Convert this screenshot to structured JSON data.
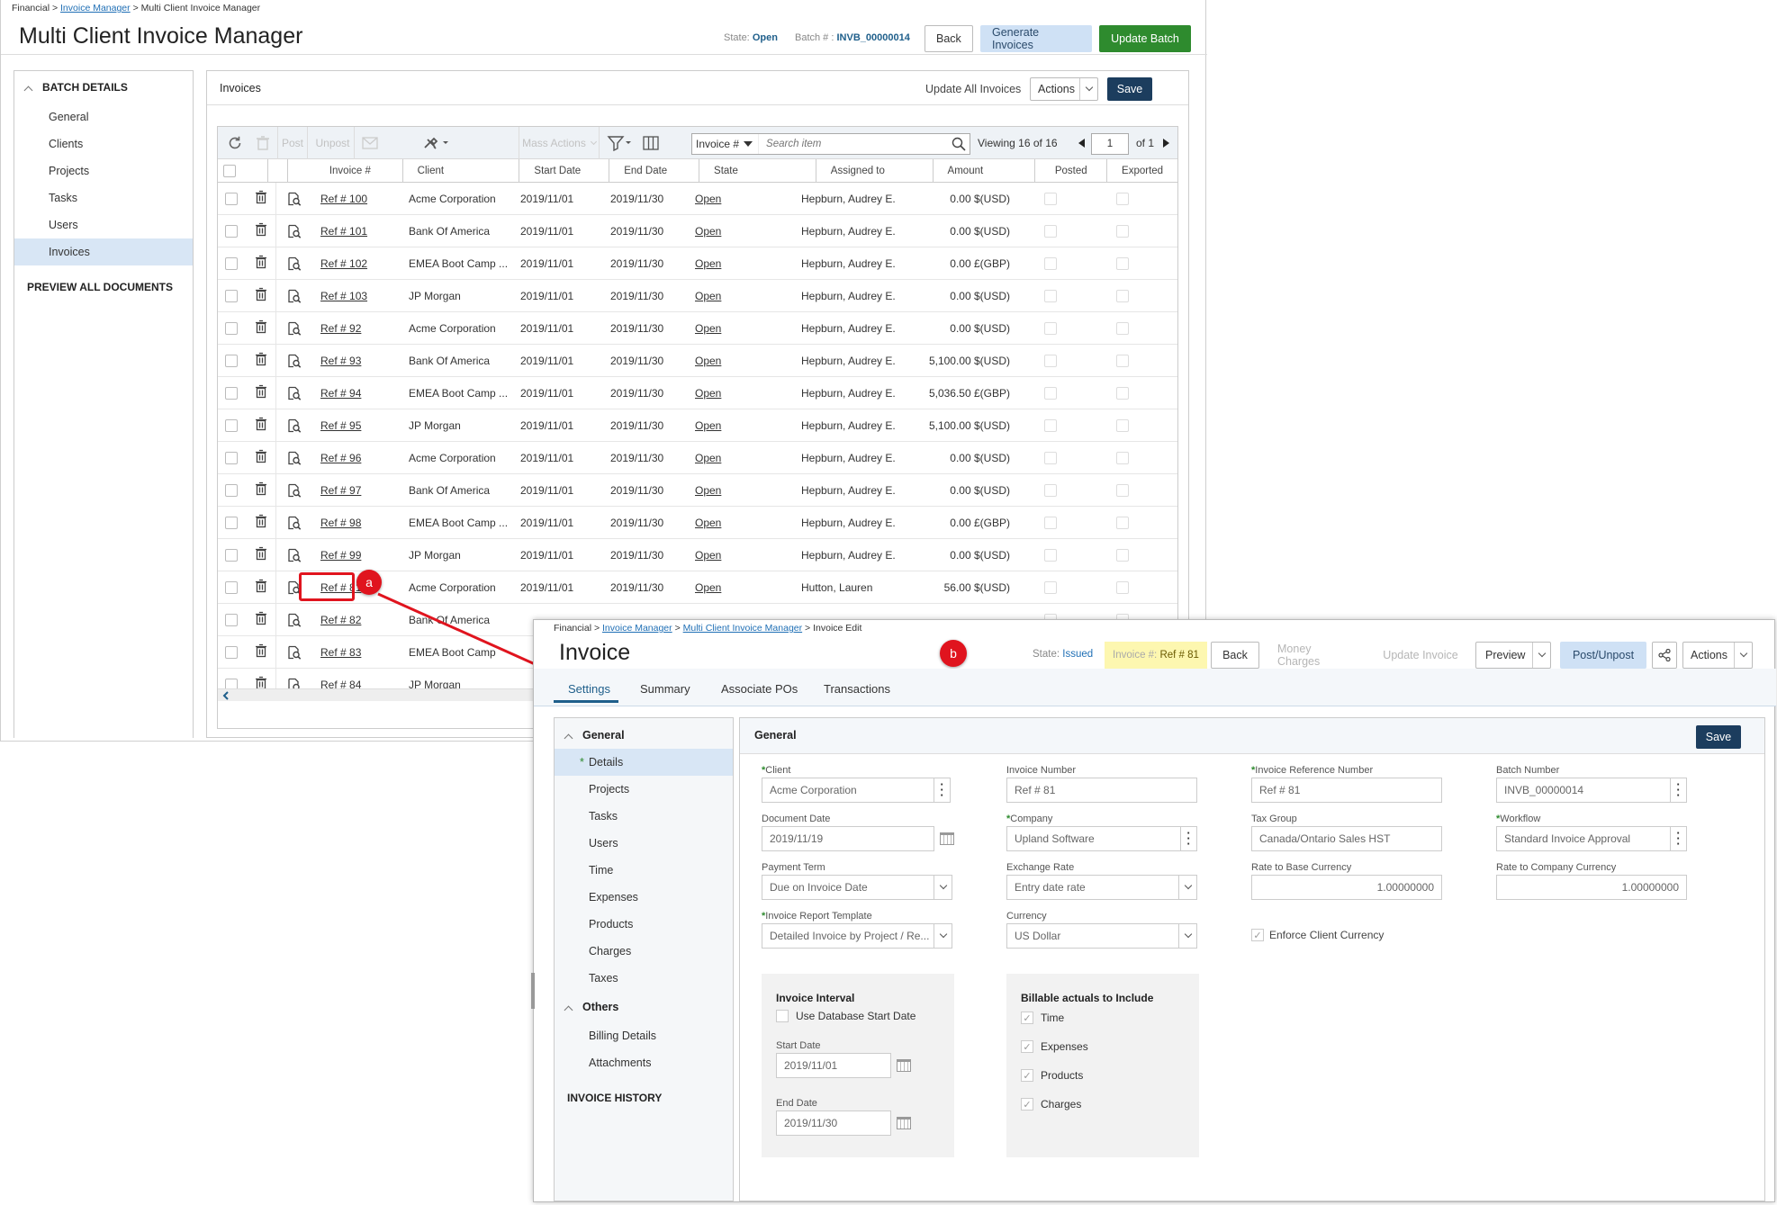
{
  "batch_window": {
    "breadcrumb": {
      "root": "Financial",
      "sep": ">",
      "link": "Invoice Manager",
      "current": "Multi Client Invoice Manager"
    },
    "title": "Multi Client Invoice Manager",
    "state_label": "State:",
    "state_value": "Open",
    "batch_label": "Batch # :",
    "batch_value": "INVB_00000014",
    "buttons": {
      "back": "Back",
      "generate": "Generate Invoices",
      "update": "Update Batch"
    },
    "sidebar": {
      "heading": "BATCH DETAILS",
      "items": [
        "General",
        "Clients",
        "Projects",
        "Tasks",
        "Users",
        "Invoices"
      ],
      "selected": "Invoices",
      "preview": "PREVIEW ALL DOCUMENTS"
    },
    "panel": {
      "title": "Invoices",
      "update_all": "Update All Invoices",
      "actions": "Actions",
      "save": "Save",
      "toolbar": {
        "post": "Post",
        "unpost": "Unpost",
        "mass_actions": "Mass Actions",
        "search_field": "Invoice #",
        "search_placeholder": "Search item",
        "viewing_label": "Viewing",
        "viewing_count": "16",
        "viewing_of": "of",
        "viewing_total": "16",
        "page": "1",
        "page_of": "of 1"
      },
      "columns": [
        "Invoice #",
        "Client",
        "Start Date",
        "End Date",
        "State",
        "Assigned to",
        "Amount",
        "Posted",
        "Exported"
      ],
      "rows": [
        {
          "ref": "Ref # 100",
          "client": "Acme Corporation",
          "start": "2019/11/01",
          "end": "2019/11/30",
          "state": "Open",
          "assigned": "Hepburn, Audrey E.",
          "amount": "0.00 $(USD)"
        },
        {
          "ref": "Ref # 101",
          "client": "Bank Of America",
          "start": "2019/11/01",
          "end": "2019/11/30",
          "state": "Open",
          "assigned": "Hepburn, Audrey E.",
          "amount": "0.00 $(USD)"
        },
        {
          "ref": "Ref # 102",
          "client": "EMEA Boot Camp ...",
          "start": "2019/11/01",
          "end": "2019/11/30",
          "state": "Open",
          "assigned": "Hepburn, Audrey E.",
          "amount": "0.00 £(GBP)"
        },
        {
          "ref": "Ref # 103",
          "client": "JP Morgan",
          "start": "2019/11/01",
          "end": "2019/11/30",
          "state": "Open",
          "assigned": "Hepburn, Audrey E.",
          "amount": "0.00 $(USD)"
        },
        {
          "ref": "Ref # 92",
          "client": "Acme Corporation",
          "start": "2019/11/01",
          "end": "2019/11/30",
          "state": "Open",
          "assigned": "Hepburn, Audrey E.",
          "amount": "0.00 $(USD)"
        },
        {
          "ref": "Ref # 93",
          "client": "Bank Of America",
          "start": "2019/11/01",
          "end": "2019/11/30",
          "state": "Open",
          "assigned": "Hepburn, Audrey E.",
          "amount": "5,100.00 $(USD)"
        },
        {
          "ref": "Ref # 94",
          "client": "EMEA Boot Camp ...",
          "start": "2019/11/01",
          "end": "2019/11/30",
          "state": "Open",
          "assigned": "Hepburn, Audrey E.",
          "amount": "5,036.50 £(GBP)"
        },
        {
          "ref": "Ref # 95",
          "client": "JP Morgan",
          "start": "2019/11/01",
          "end": "2019/11/30",
          "state": "Open",
          "assigned": "Hepburn, Audrey E.",
          "amount": "5,100.00 $(USD)"
        },
        {
          "ref": "Ref # 96",
          "client": "Acme Corporation",
          "start": "2019/11/01",
          "end": "2019/11/30",
          "state": "Open",
          "assigned": "Hepburn, Audrey E.",
          "amount": "0.00 $(USD)"
        },
        {
          "ref": "Ref # 97",
          "client": "Bank Of America",
          "start": "2019/11/01",
          "end": "2019/11/30",
          "state": "Open",
          "assigned": "Hepburn, Audrey E.",
          "amount": "0.00 $(USD)"
        },
        {
          "ref": "Ref # 98",
          "client": "EMEA Boot Camp ...",
          "start": "2019/11/01",
          "end": "2019/11/30",
          "state": "Open",
          "assigned": "Hepburn, Audrey E.",
          "amount": "0.00 £(GBP)"
        },
        {
          "ref": "Ref # 99",
          "client": "JP Morgan",
          "start": "2019/11/01",
          "end": "2019/11/30",
          "state": "Open",
          "assigned": "Hepburn, Audrey E.",
          "amount": "0.00 $(USD)"
        },
        {
          "ref": "Ref # 81",
          "client": "Acme Corporation",
          "start": "2019/11/01",
          "end": "2019/11/30",
          "state": "Open",
          "assigned": "Hutton, Lauren",
          "amount": "56.00 $(USD)"
        },
        {
          "ref": "Ref # 82",
          "client": "Bank Of America",
          "start": "",
          "end": "",
          "state": "",
          "assigned": "",
          "amount": ""
        },
        {
          "ref": "Ref # 83",
          "client": "EMEA Boot Camp",
          "start": "",
          "end": "",
          "state": "",
          "assigned": "",
          "amount": ""
        },
        {
          "ref": "Ref # 84",
          "client": "JP Morgan",
          "start": "",
          "end": "",
          "state": "",
          "assigned": "",
          "amount": ""
        }
      ]
    }
  },
  "callouts": {
    "a": "a",
    "b": "b",
    "color": "#e0141e"
  },
  "invoice_window": {
    "breadcrumb": {
      "root": "Financial",
      "sep": ">",
      "link1": "Invoice Manager",
      "link2": "Multi Client Invoice Manager",
      "current": "Invoice Edit"
    },
    "title": "Invoice",
    "state_label": "State:",
    "state_value": "Issued",
    "invoice_label": "Invoice #:",
    "invoice_value": "Ref # 81",
    "buttons": {
      "back": "Back",
      "money_charges": "Money Charges",
      "update_invoice": "Update Invoice",
      "preview": "Preview",
      "post_unpost": "Post/Unpost",
      "actions": "Actions"
    },
    "tabs": [
      "Settings",
      "Summary",
      "Associate POs",
      "Transactions"
    ],
    "nav": {
      "general_heading": "General",
      "general_items": [
        "Details",
        "Projects",
        "Tasks",
        "Users",
        "Time",
        "Expenses",
        "Products",
        "Charges",
        "Taxes"
      ],
      "selected": "Details",
      "others_heading": "Others",
      "others_items": [
        "Billing Details",
        "Attachments"
      ],
      "history": "INVOICE HISTORY"
    },
    "general": {
      "title": "General",
      "save": "Save",
      "client_label": "Client",
      "client_value": "Acme Corporation",
      "invoice_number_label": "Invoice Number",
      "invoice_number_value": "Ref # 81",
      "invoice_ref_label": "Invoice Reference Number",
      "invoice_ref_value": "Ref # 81",
      "batch_number_label": "Batch Number",
      "batch_number_value": "INVB_00000014",
      "document_date_label": "Document Date",
      "document_date_value": "2019/11/19",
      "company_label": "Company",
      "company_value": "Upland Software",
      "tax_group_label": "Tax Group",
      "tax_group_value": "Canada/Ontario Sales HST",
      "workflow_label": "Workflow",
      "workflow_value": "Standard Invoice Approval",
      "payment_term_label": "Payment Term",
      "payment_term_value": "Due on Invoice Date",
      "exchange_rate_label": "Exchange Rate",
      "exchange_rate_value": "Entry date rate",
      "rate_base_label": "Rate to Base Currency",
      "rate_base_value": "1.00000000",
      "rate_company_label": "Rate to Company Currency",
      "rate_company_value": "1.00000000",
      "report_template_label": "Invoice Report Template",
      "report_template_value": "Detailed Invoice by Project / Re...",
      "currency_label": "Currency",
      "currency_value": "US Dollar",
      "enforce_label": "Enforce Client Currency",
      "interval": {
        "title": "Invoice Interval",
        "use_db_label": "Use Database Start Date",
        "start_label": "Start Date",
        "start_value": "2019/11/01",
        "end_label": "End Date",
        "end_value": "2019/11/30"
      },
      "billable": {
        "title": "Billable actuals to Include",
        "items": [
          "Time",
          "Expenses",
          "Products",
          "Charges"
        ]
      }
    }
  }
}
